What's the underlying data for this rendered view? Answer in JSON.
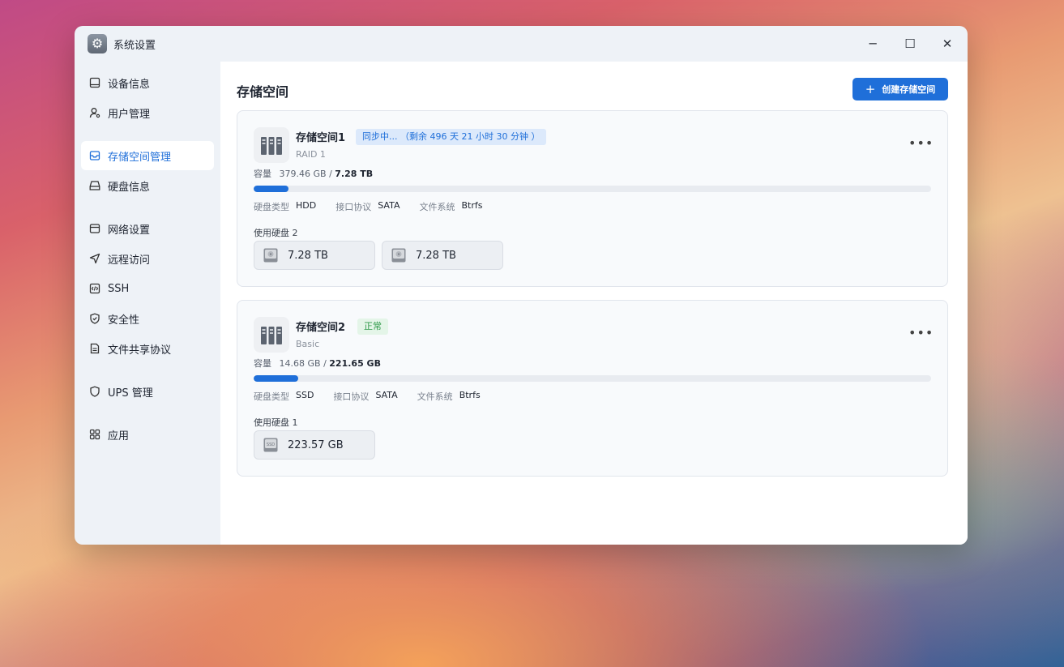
{
  "window": {
    "title": "系统设置",
    "controls": {
      "minimize": "─",
      "maximize": "☐",
      "close": "✕"
    }
  },
  "sidebar": {
    "items": [
      {
        "label": "设备信息",
        "icon": "device-icon"
      },
      {
        "label": "用户管理",
        "icon": "user-icon"
      },
      {
        "label": "存储空间管理",
        "icon": "storage-icon",
        "active": true
      },
      {
        "label": "硬盘信息",
        "icon": "disk-icon"
      },
      {
        "label": "网络设置",
        "icon": "network-icon"
      },
      {
        "label": "远程访问",
        "icon": "remote-icon"
      },
      {
        "label": "SSH",
        "icon": "ssh-icon"
      },
      {
        "label": "安全性",
        "icon": "shield-icon"
      },
      {
        "label": "文件共享协议",
        "icon": "file-share-icon"
      },
      {
        "label": "UPS 管理",
        "icon": "ups-icon"
      },
      {
        "label": "应用",
        "icon": "apps-icon"
      }
    ]
  },
  "main": {
    "title": "存储空间",
    "create_button": "创建存储空间",
    "pools": [
      {
        "name": "存储空间1",
        "status": "同步中... （剩余 496 天 21 小时 30 分钟 ）",
        "status_type": "sync",
        "raid": "RAID 1",
        "capacity_label": "容量",
        "used": "379.46 GB",
        "separator": "/",
        "total": "7.28 TB",
        "usage_fraction": 0.051,
        "specs": [
          {
            "label": "硬盘类型",
            "value": "HDD"
          },
          {
            "label": "接口协议",
            "value": "SATA"
          },
          {
            "label": "文件系统",
            "value": "Btrfs"
          }
        ],
        "disks_label": "使用硬盘 2",
        "disks": [
          {
            "size": "7.28 TB",
            "kind": "hdd"
          },
          {
            "size": "7.28 TB",
            "kind": "hdd"
          }
        ]
      },
      {
        "name": "存储空间2",
        "status": "正常",
        "status_type": "ok",
        "raid": "Basic",
        "capacity_label": "容量",
        "used": "14.68 GB",
        "separator": "/",
        "total": "221.65 GB",
        "usage_fraction": 0.066,
        "specs": [
          {
            "label": "硬盘类型",
            "value": "SSD"
          },
          {
            "label": "接口协议",
            "value": "SATA"
          },
          {
            "label": "文件系统",
            "value": "Btrfs"
          }
        ],
        "disks_label": "使用硬盘 1",
        "disks": [
          {
            "size": "223.57 GB",
            "kind": "ssd"
          }
        ]
      }
    ]
  },
  "colors": {
    "accent": "#1f6fd9",
    "ok": "#2f9a4a",
    "sidebar_bg": "#eef2f7"
  }
}
